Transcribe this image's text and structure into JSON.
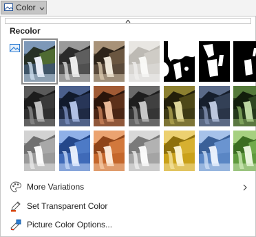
{
  "toolbar": {
    "color_button": {
      "label": "Color",
      "icon": "picture-icon",
      "dropdown_icon": "chevron-down-icon"
    }
  },
  "panel": {
    "scroll_up_icon": "chevron-up-icon",
    "section_title": "Recolor",
    "section_icon": "picture-icon",
    "swatches": [
      {
        "row": 0,
        "col": 0,
        "style": "original",
        "selected": true
      },
      {
        "row": 0,
        "col": 1,
        "style": "grayscale",
        "selected": false
      },
      {
        "row": 0,
        "col": 2,
        "style": "sepia",
        "selected": false
      },
      {
        "row": 0,
        "col": 3,
        "style": "washout",
        "selected": false
      },
      {
        "row": 0,
        "col": 4,
        "style": "black-white-25",
        "selected": false
      },
      {
        "row": 0,
        "col": 5,
        "style": "black-white-50",
        "selected": false
      },
      {
        "row": 0,
        "col": 6,
        "style": "black-white-75",
        "selected": false
      },
      {
        "row": 1,
        "col": 0,
        "style": "dark-gray",
        "selected": false
      },
      {
        "row": 1,
        "col": 1,
        "style": "dark-blue",
        "selected": false
      },
      {
        "row": 1,
        "col": 2,
        "style": "dark-orange",
        "selected": false
      },
      {
        "row": 1,
        "col": 3,
        "style": "dark-gray-2",
        "selected": false
      },
      {
        "row": 1,
        "col": 4,
        "style": "dark-gold",
        "selected": false
      },
      {
        "row": 1,
        "col": 5,
        "style": "dark-blue-2",
        "selected": false
      },
      {
        "row": 1,
        "col": 6,
        "style": "dark-green",
        "selected": false
      },
      {
        "row": 2,
        "col": 0,
        "style": "light-gray",
        "selected": false
      },
      {
        "row": 2,
        "col": 1,
        "style": "light-blue",
        "selected": false
      },
      {
        "row": 2,
        "col": 2,
        "style": "light-orange",
        "selected": false
      },
      {
        "row": 2,
        "col": 3,
        "style": "light-gray-2",
        "selected": false
      },
      {
        "row": 2,
        "col": 4,
        "style": "light-gold",
        "selected": false
      },
      {
        "row": 2,
        "col": 5,
        "style": "light-blue-2",
        "selected": false
      },
      {
        "row": 2,
        "col": 6,
        "style": "light-green",
        "selected": false
      }
    ],
    "menu": [
      {
        "label": "More Variations",
        "icon": "palette-icon",
        "submenu_icon": "chevron-right-icon"
      },
      {
        "label": "Set Transparent Color",
        "icon": "pen-icon"
      },
      {
        "label": "Picture Color Options...",
        "icon": "color-options-icon"
      }
    ]
  }
}
